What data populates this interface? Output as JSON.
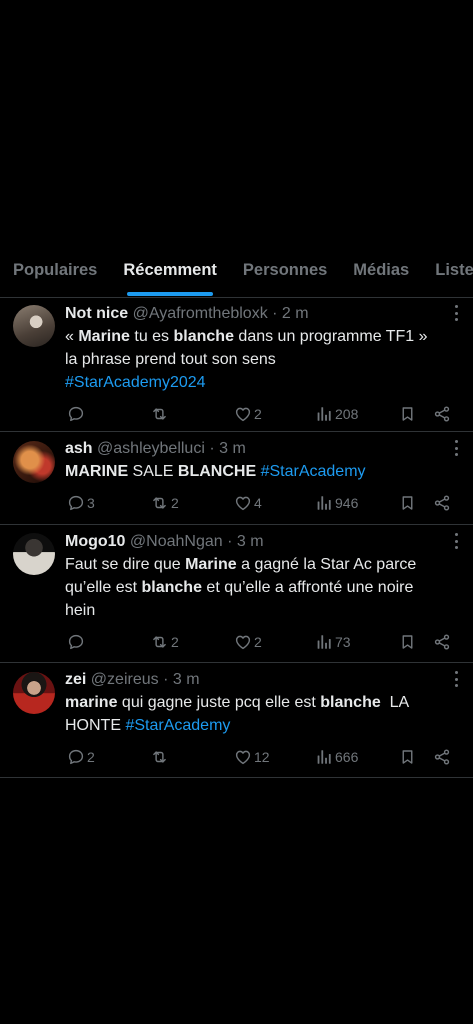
{
  "tabs": [
    "Populaires",
    "Récemment",
    "Personnes",
    "Médias",
    "Listes"
  ],
  "active_tab_index": 1,
  "colors": {
    "background": "#000000",
    "accent": "#1d9bf0",
    "muted": "#71767b",
    "text": "#e7e9ea",
    "divider": "#2f3336"
  },
  "tweets": [
    {
      "name": "Not nice",
      "handle": "@Ayafromthebloxk",
      "time": "· 2 m",
      "text_lines": [
        [
          {
            "t": "« ",
            "s": "n"
          },
          {
            "t": "Marine",
            "s": "b"
          },
          {
            "t": " tu es ",
            "s": "n"
          },
          {
            "t": "blanche",
            "s": "b"
          },
          {
            "t": " dans un programme TF1 »",
            "s": "n"
          }
        ],
        [
          {
            "t": "la phrase prend tout son sens",
            "s": "n"
          }
        ],
        [
          {
            "t": "#StarAcademy2024",
            "s": "h"
          }
        ]
      ],
      "replies": "",
      "retweets": "",
      "likes": "2",
      "views": "208"
    },
    {
      "name": "ash",
      "handle": "@ashleybelluci",
      "time": "· 3 m",
      "text_lines": [
        [
          {
            "t": "MARINE",
            "s": "b"
          },
          {
            "t": " SALE ",
            "s": "n"
          },
          {
            "t": "BLANCHE",
            "s": "b"
          },
          {
            "t": " ",
            "s": "n"
          },
          {
            "t": "#StarAcademy",
            "s": "h"
          }
        ]
      ],
      "replies": "3",
      "retweets": "2",
      "likes": "4",
      "views": "946"
    },
    {
      "name": "Mogo10",
      "handle": "@NoahNgan",
      "time": "· 3 m",
      "text_lines": [
        [
          {
            "t": "Faut se dire que ",
            "s": "n"
          },
          {
            "t": "Marine",
            "s": "b"
          },
          {
            "t": " a gagné la Star Ac parce",
            "s": "n"
          }
        ],
        [
          {
            "t": "qu’elle est ",
            "s": "n"
          },
          {
            "t": "blanche",
            "s": "b"
          },
          {
            "t": " et qu’elle a affronté une noire",
            "s": "n"
          }
        ],
        [
          {
            "t": "hein",
            "s": "n"
          }
        ]
      ],
      "replies": "",
      "retweets": "2",
      "likes": "2",
      "views": "73"
    },
    {
      "name": "zei",
      "handle": "@zeireus",
      "time": "· 3 m",
      "text_lines": [
        [
          {
            "t": "marine",
            "s": "b"
          },
          {
            "t": " qui gagne juste pcq elle est ",
            "s": "n"
          },
          {
            "t": "blanche",
            "s": "b"
          },
          {
            "t": "  LA",
            "s": "n"
          }
        ],
        [
          {
            "t": "HONTE ",
            "s": "n"
          },
          {
            "t": "#StarAcademy",
            "s": "h"
          }
        ]
      ],
      "replies": "2",
      "retweets": "",
      "likes": "12",
      "views": "666"
    }
  ]
}
